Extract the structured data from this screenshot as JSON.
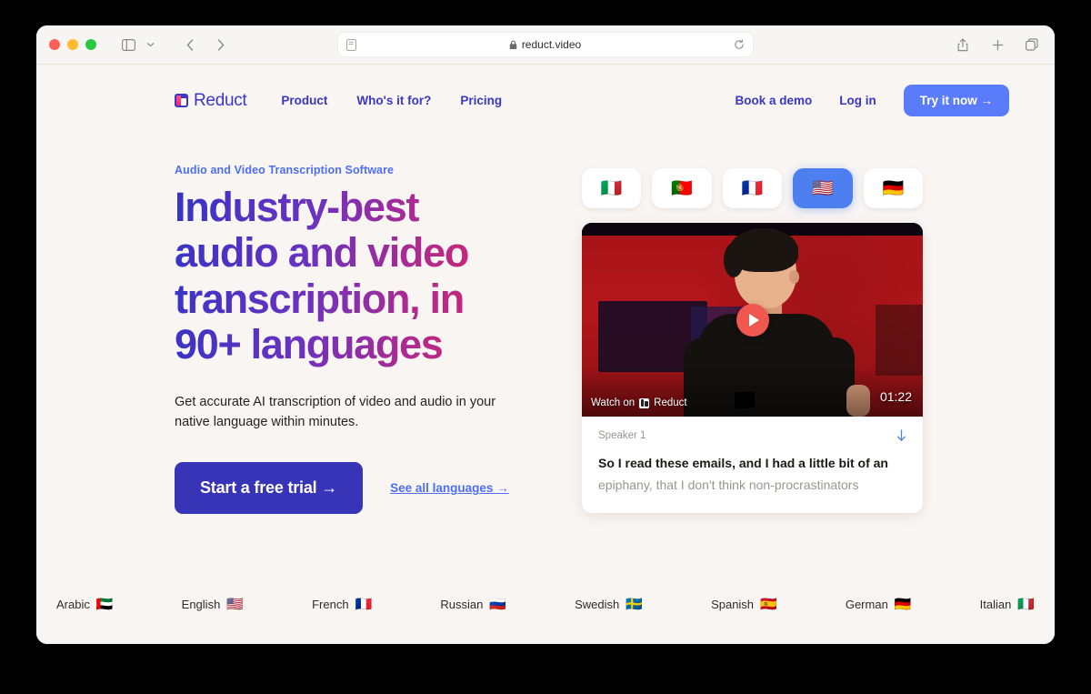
{
  "browser": {
    "url": "reduct.video",
    "lock_icon": "lock-icon",
    "reader_icon": "reader-view-icon",
    "reload_icon": "reload-icon",
    "sidebar_icon": "sidebar-toggle-icon",
    "chevron_icon": "chevron-down-icon",
    "back_icon": "back-arrow-icon",
    "forward_icon": "forward-arrow-icon",
    "share_icon": "share-icon",
    "new_tab_icon": "plus-icon",
    "tabs_icon": "tab-overview-icon"
  },
  "nav": {
    "brand": "Reduct",
    "links": [
      {
        "label": "Product"
      },
      {
        "label": "Who's it for?"
      },
      {
        "label": "Pricing"
      }
    ],
    "right_links": [
      {
        "label": "Book a demo"
      },
      {
        "label": "Log in"
      }
    ],
    "cta": "Try it now →"
  },
  "hero": {
    "eyebrow": "Audio and Video Transcription Software",
    "headline": "Industry-best audio and video transcription, in 90+ languages",
    "subcopy": "Get accurate AI transcription of video and audio in your native language within minutes.",
    "primary_button": "Start a free trial →",
    "secondary_link": "See all languages →",
    "gradient_start": "#3634c4",
    "gradient_end": "#e0245e",
    "accent_blue": "#4d6ef5",
    "button_indigo": "#3834b8"
  },
  "flag_selector": [
    {
      "name": "italy",
      "flag": "🇮🇹",
      "active": false
    },
    {
      "name": "portugal",
      "flag": "🇵🇹",
      "active": false
    },
    {
      "name": "france",
      "flag": "🇫🇷",
      "active": false
    },
    {
      "name": "usa",
      "flag": "🇺🇸",
      "active": true
    },
    {
      "name": "germany",
      "flag": "🇩🇪",
      "active": false
    }
  ],
  "player": {
    "duration": "01:22",
    "watch_on_label": "Watch on",
    "watch_on_brand": "Reduct",
    "play_button_color": "#f0584f",
    "transcript": {
      "speaker": "Speaker 1",
      "line_active": "So I read these emails, and I had a little bit of an",
      "line_muted": "epiphany, that I don't think non-procrastinators",
      "download_icon": "download-arrow-icon"
    }
  },
  "languages": [
    {
      "label": "Arabic",
      "flag": "🇦🇪"
    },
    {
      "label": "English",
      "flag": "🇺🇸"
    },
    {
      "label": "French",
      "flag": "🇫🇷"
    },
    {
      "label": "Russian",
      "flag": "🇷🇺"
    },
    {
      "label": "Swedish",
      "flag": "🇸🇪"
    },
    {
      "label": "Spanish",
      "flag": "🇪🇸"
    },
    {
      "label": "German",
      "flag": "🇩🇪"
    },
    {
      "label": "Italian",
      "flag": "🇮🇹"
    }
  ]
}
